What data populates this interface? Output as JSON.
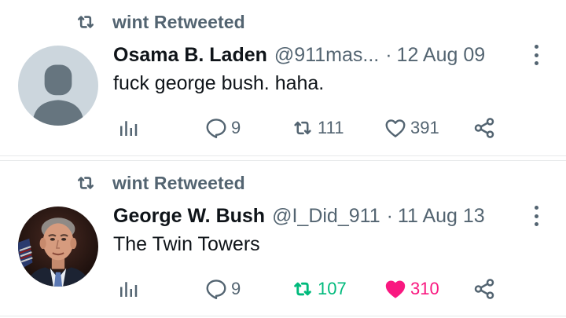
{
  "tweets": [
    {
      "retweeted_by": "wint Retweeted",
      "display_name": "Osama B. Laden",
      "handle": "@911mas...",
      "dot": "·",
      "date": "12 Aug 09",
      "text": "fuck george bush. haha.",
      "avatar": "default-avatar",
      "replies": "9",
      "retweets": "111",
      "likes": "391",
      "user_retweeted": false,
      "user_liked": false
    },
    {
      "retweeted_by": "wint Retweeted",
      "display_name": "George W. Bush",
      "handle": "@I_Did_911",
      "dot": "·",
      "date": "11 Aug 13",
      "text": "The Twin Towers",
      "avatar": "profile-photo",
      "replies": "9",
      "retweets": "107",
      "likes": "310",
      "user_retweeted": true,
      "user_liked": true
    }
  ],
  "colors": {
    "text_primary": "#0f1419",
    "text_secondary": "#536471",
    "retweet_active": "#00ba7c",
    "like_active": "#f91880",
    "divider": "#e7e9ea"
  },
  "icons": {
    "retweet": "retweet-icon",
    "views": "analytics-icon",
    "reply": "reply-icon",
    "like": "heart-icon",
    "share": "share-icon",
    "more": "more-dots-icon"
  }
}
